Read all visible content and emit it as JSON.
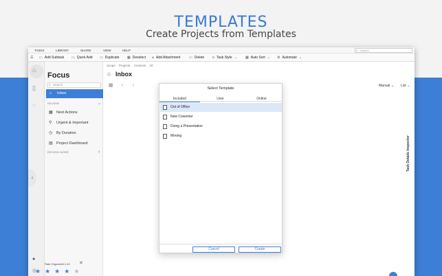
{
  "promo": {
    "title": "TEMPLATES",
    "subtitle": "Create Projects from Templates"
  },
  "menubar": {
    "items": [
      "TASKS",
      "LIBRARY",
      "SHARE",
      "VIEW",
      "HELP"
    ],
    "search_placeholder": "Search"
  },
  "toolbar": {
    "items": [
      "Add Subtask",
      "Quick Add",
      "Duplicate",
      "Deselect",
      "Add Attachment",
      "Delete",
      "Task Style",
      "Auto Sort",
      "Automate"
    ]
  },
  "sidebar": {
    "title": "Focus",
    "search_placeholder": "Search",
    "active_item": "Inbox",
    "review_label": "REVIEW",
    "items": [
      "Next Actions",
      "Urgent & Important",
      "By Duration",
      "Project Dashboard"
    ],
    "review_more_label": "REVIEW MORE",
    "rate_text": "Rate Organizeit 4.10",
    "rating": 4,
    "rating_max": 5
  },
  "main": {
    "breadcrumbs": [
      "Scope",
      "Projects",
      "Contexts",
      "All"
    ],
    "title": "Inbox",
    "sort_label": "Manual",
    "view_label": "List",
    "inspector_label": "Task Details Inspector"
  },
  "dialog": {
    "title": "Select Template",
    "tabs": [
      "Included",
      "User",
      "Online"
    ],
    "active_tab": "Included",
    "templates": [
      "Out of Office",
      "New Coworker",
      "Doing a Presentation",
      "Moving"
    ],
    "selected_template": "Out of Office",
    "cancel_label": "Cancel",
    "create_label": "Create"
  },
  "colors": {
    "accent": "#3d7fd6",
    "background_band": "#3d7fd6",
    "selected_row": "#dce8f7"
  }
}
